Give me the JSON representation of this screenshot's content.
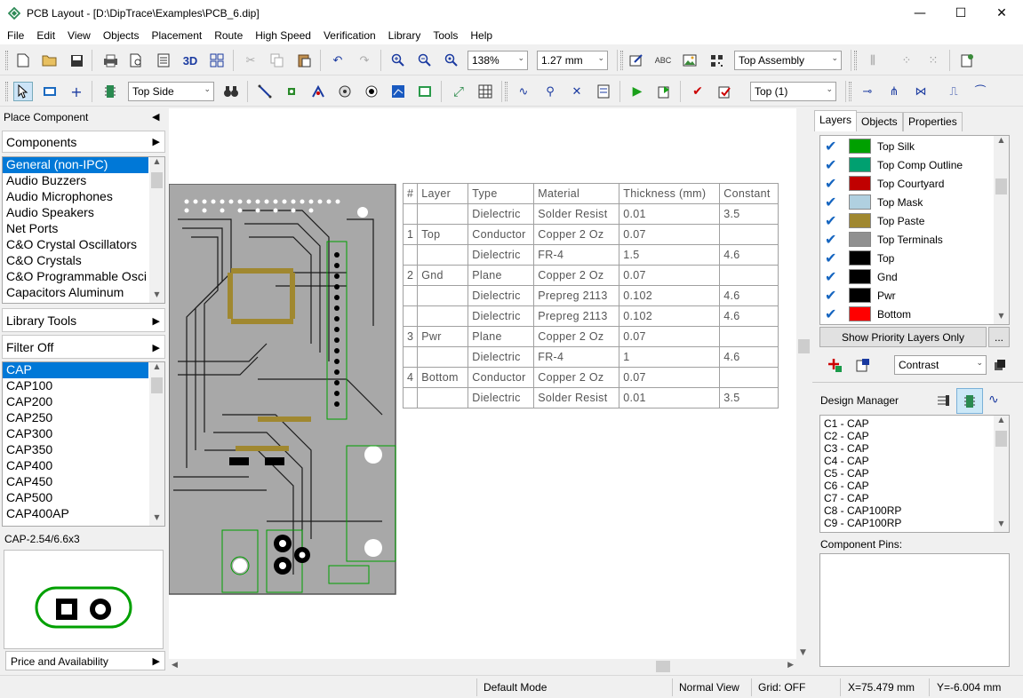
{
  "window": {
    "title": "PCB Layout - [D:\\DipTrace\\Examples\\PCB_6.dip]",
    "minimize": "—",
    "maximize": "☐",
    "close": "✕"
  },
  "menu": [
    "File",
    "Edit",
    "View",
    "Objects",
    "Placement",
    "Route",
    "High Speed",
    "Verification",
    "Library",
    "Tools",
    "Help"
  ],
  "toolbar1": {
    "zoom_value": "138%",
    "grid_value": "1.27 mm",
    "view_mode": "Top Assembly",
    "label_3d": "3D"
  },
  "toolbar2": {
    "side": "Top Side",
    "layer": "Top (1)"
  },
  "left_panel": {
    "place_component": "Place Component",
    "components": "Components",
    "libraries": [
      "General (non-IPC)",
      "Audio Buzzers",
      "Audio Microphones",
      "Audio Speakers",
      "Net Ports",
      "C&O Crystal Oscillators",
      "C&O Crystals",
      "C&O Programmable Osci",
      "Capacitors Aluminum"
    ],
    "library_tools": "Library Tools",
    "filter": "Filter Off",
    "parts": [
      "CAP",
      "CAP100",
      "CAP200",
      "CAP250",
      "CAP300",
      "CAP350",
      "CAP400",
      "CAP450",
      "CAP500",
      "CAP400AP"
    ],
    "pattern_name": "CAP-2.54/6.6x3",
    "price": "Price and Availability"
  },
  "layer_stack": {
    "headers": [
      "#",
      "Layer",
      "Type",
      "Material",
      "Thickness (mm)",
      "Constant"
    ],
    "rows": [
      [
        "",
        "",
        "Dielectric",
        "Solder Resist",
        "0.01",
        "3.5"
      ],
      [
        "1",
        "Top",
        "Conductor",
        "Copper 2 Oz",
        "0.07",
        ""
      ],
      [
        "",
        "",
        "Dielectric",
        "FR-4",
        "1.5",
        "4.6"
      ],
      [
        "2",
        "Gnd",
        "Plane",
        "Copper 2 Oz",
        "0.07",
        ""
      ],
      [
        "",
        "",
        "Dielectric",
        "Prepreg 2113",
        "0.102",
        "4.6"
      ],
      [
        "",
        "",
        "Dielectric",
        "Prepreg 2113",
        "0.102",
        "4.6"
      ],
      [
        "3",
        "Pwr",
        "Plane",
        "Copper 2 Oz",
        "0.07",
        ""
      ],
      [
        "",
        "",
        "Dielectric",
        "FR-4",
        "1",
        "4.6"
      ],
      [
        "4",
        "Bottom",
        "Conductor",
        "Copper 2 Oz",
        "0.07",
        ""
      ],
      [
        "",
        "",
        "Dielectric",
        "Solder Resist",
        "0.01",
        "3.5"
      ]
    ]
  },
  "right_panel": {
    "tabs": [
      "Layers",
      "Objects",
      "Properties"
    ],
    "layers": [
      {
        "name": "Top Silk",
        "color": "#00a000"
      },
      {
        "name": "Top Comp Outline",
        "color": "#00a070"
      },
      {
        "name": "Top Courtyard",
        "color": "#c00000"
      },
      {
        "name": "Top Mask",
        "color": "#b0d0e0"
      },
      {
        "name": "Top Paste",
        "color": "#a08830"
      },
      {
        "name": "Top Terminals",
        "color": "#909090"
      },
      {
        "name": "Top",
        "color": "#000000"
      },
      {
        "name": "Gnd",
        "color": "#000000"
      },
      {
        "name": "Pwr",
        "color": "#000000"
      },
      {
        "name": "Bottom",
        "color": "#ff0000"
      }
    ],
    "show_priority": "Show Priority Layers Only",
    "more": "...",
    "contrast": "Contrast",
    "design_manager": "Design Manager",
    "components": [
      "C1 - CAP",
      "C2 - CAP",
      "C3 - CAP",
      "C4 - CAP",
      "C5 - CAP",
      "C6 - CAP",
      "C7 - CAP",
      "C8 - CAP100RP",
      "C9 - CAP100RP"
    ],
    "component_pins": "Component Pins:"
  },
  "status": {
    "mode": "Default Mode",
    "view": "Normal View",
    "grid": "Grid: OFF",
    "x": "X=75.479 mm",
    "y": "Y=-6.004 mm"
  },
  "icons": {
    "check": "✔",
    "chevron_right": "▶",
    "chevron_left": "◀",
    "combo_arrow": "⌄"
  },
  "colors": {
    "selection": "#0078d7",
    "pcb_board": "#a8a8a8",
    "silk": "#00a000",
    "paste": "#a08830"
  }
}
